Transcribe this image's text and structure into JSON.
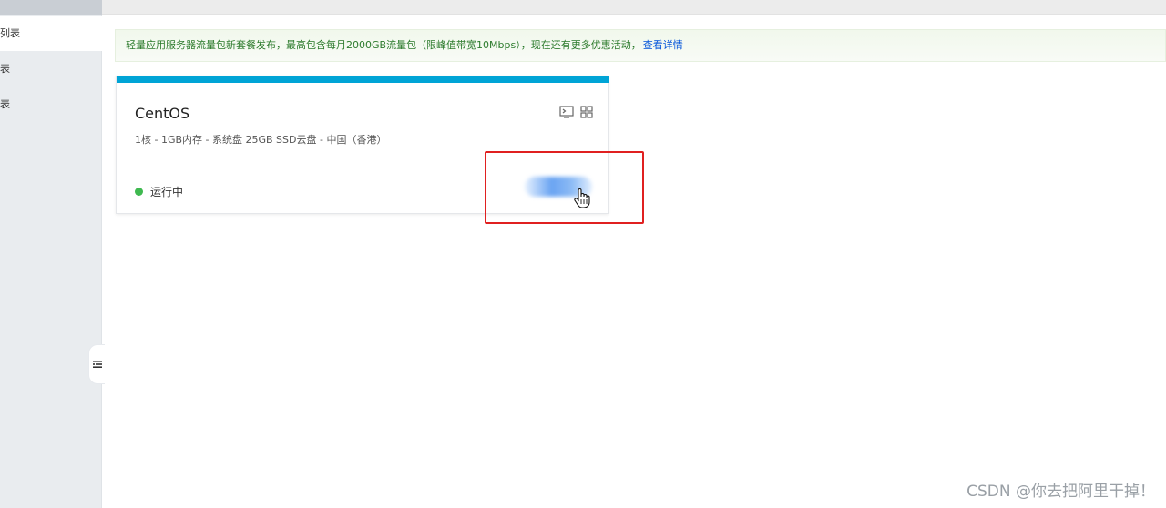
{
  "sidebar": {
    "items": [
      {
        "label": "列表",
        "active": true
      },
      {
        "label": "表",
        "active": false
      },
      {
        "label": "表",
        "active": false
      }
    ],
    "collapse_icon": "menu-collapse-icon"
  },
  "notice": {
    "text": "轻量应用服务器流量包新套餐发布，最高包含每月2000GB流量包（限峰值带宽10Mbps），现在还有更多优惠活动，",
    "link": "查看详情"
  },
  "instance_card": {
    "title": "CentOS",
    "spec": "1核 - 1GB内存 - 系统盘 25GB SSD云盘 - 中国（香港）",
    "status": "运行中",
    "status_color": "#3fb950",
    "accent_color": "#00a4d6",
    "icons": [
      "terminal-icon",
      "grid-icon"
    ]
  },
  "watermark": "CSDN @你去把阿里干掉！"
}
